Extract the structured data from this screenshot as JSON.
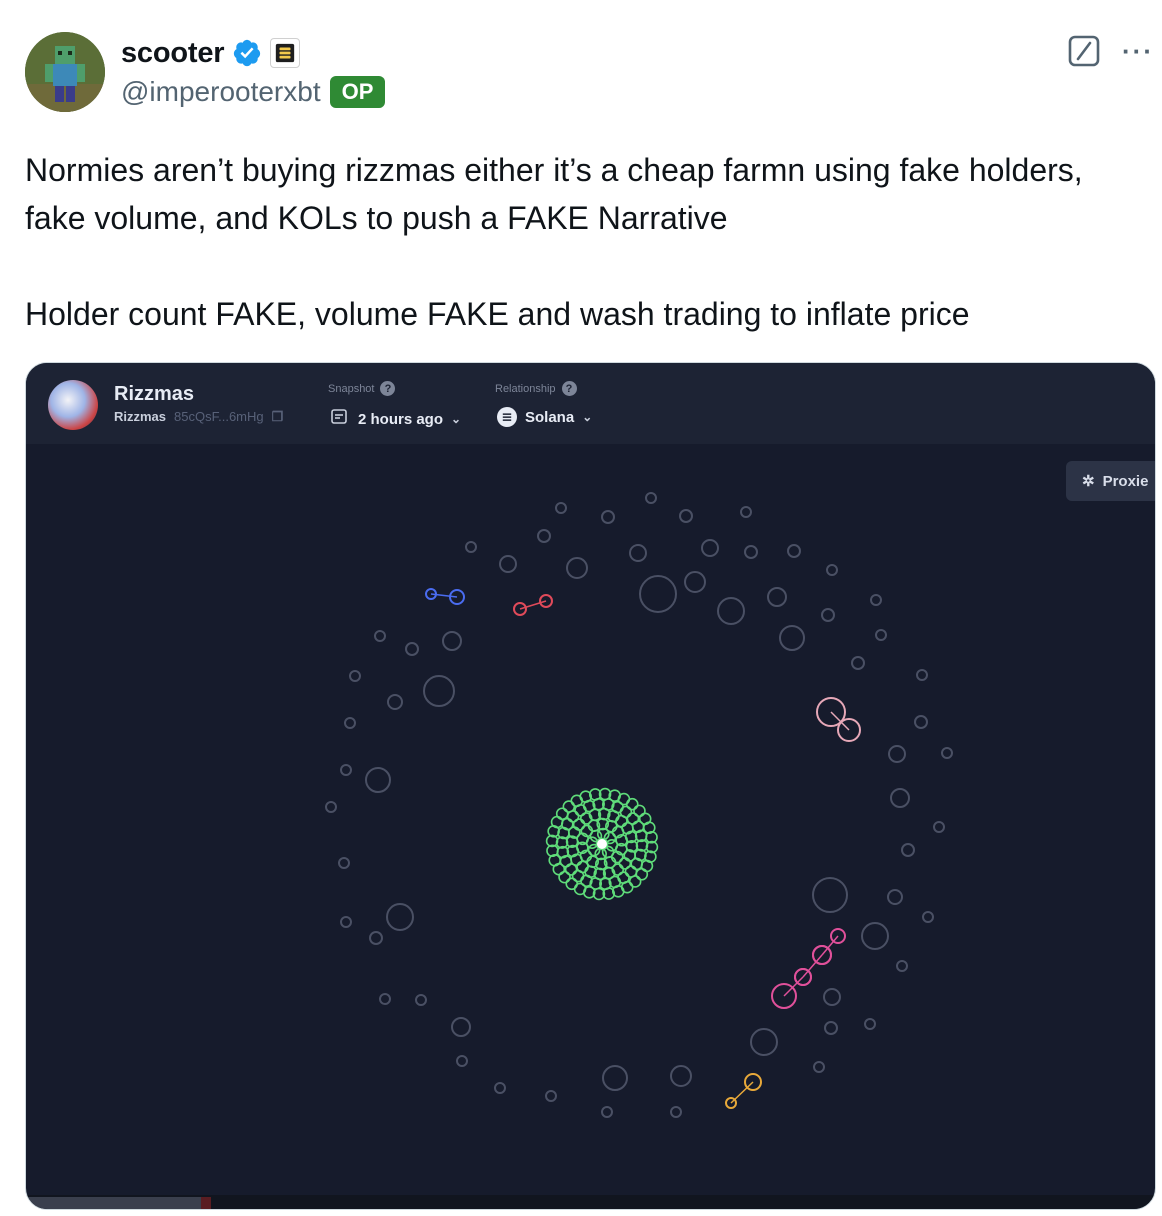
{
  "author": {
    "display_name": "scooter",
    "handle": "@imperooterxbt",
    "badge": "OP",
    "verified_icon": "verified-badge-icon",
    "affiliation_icon": "affiliation-badge-icon",
    "badge_color": "#2f8a34",
    "verified_color": "#1d9bf0"
  },
  "actions": {
    "grok_icon": "grok-icon",
    "more_icon": "more-horizontal-icon",
    "more_label": "···"
  },
  "tweet": {
    "paragraph_1": "Normies aren’t buying rizzmas either it’s a cheap farmn using fake holders, fake volume, and KOLs to push a FAKE Narrative",
    "paragraph_2": "Holder count FAKE, volume FAKE and wash trading to inflate price"
  },
  "embedded_app": {
    "token_name": "Rizzmas",
    "token_symbol": "Rizzmas",
    "token_address": "85cQsF...6mHg",
    "snapshot_label": "Snapshot",
    "snapshot_value": "2 hours ago",
    "relationship_label": "Relationship",
    "relationship_value": "Solana",
    "proxies_label": "Proxie",
    "background_color": "#161b2c",
    "cluster_color": "#5fdc7a",
    "cluster_colors": [
      "#4a6cf0",
      "#e04a5a",
      "#e6a8b8",
      "#e0509a",
      "#e8a93a"
    ]
  }
}
